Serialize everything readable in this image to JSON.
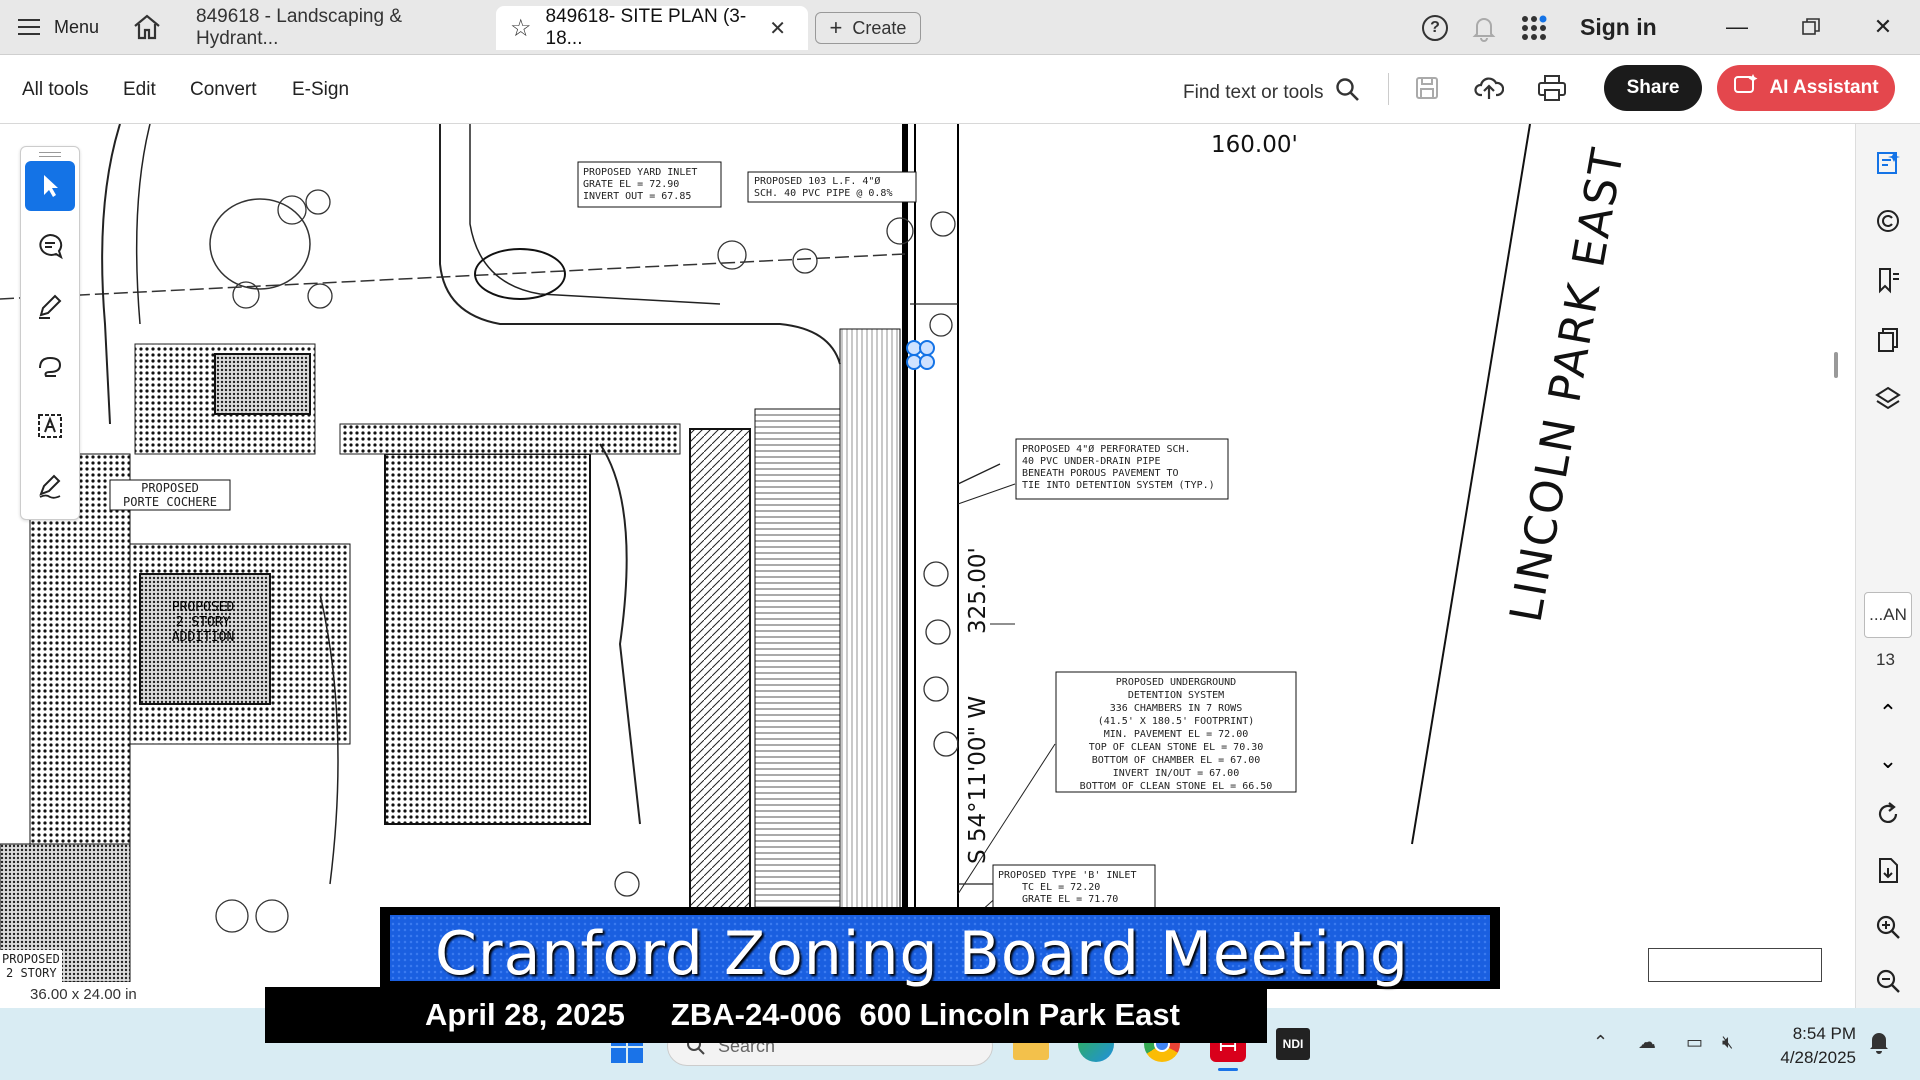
{
  "titlebar": {
    "menu_label": "Menu",
    "tabs": [
      {
        "label": "849618 - Landscaping & Hydrant..."
      },
      {
        "label": "849618- SITE PLAN (3-18..."
      }
    ],
    "create_label": "Create",
    "sign_in_label": "Sign in"
  },
  "toolbar": {
    "items": [
      "All tools",
      "Edit",
      "Convert",
      "E-Sign"
    ],
    "find_label": "Find text or tools",
    "share_label": "Share",
    "ai_label": "AI Assistant"
  },
  "drawing": {
    "dim_top": "160.00'",
    "dim_right": "325.00'",
    "bearing": "S 54°11'00\" W",
    "street": "LINCOLN PARK EAST",
    "notes": {
      "yard_inlet": [
        "PROPOSED YARD INLET",
        "GRATE EL = 72.90",
        "INVERT OUT = 67.85"
      ],
      "pvc_pipe": [
        "PROPOSED 103 L.F. 4\"Ø",
        "SCH. 40 PVC PIPE @ 0.8%"
      ],
      "underdrain": [
        "PROPOSED 4\"Ø PERFORATED SCH.",
        "40 PVC UNDER-DRAIN PIPE",
        "BENEATH POROUS PAVEMENT TO",
        "TIE INTO DETENTION SYSTEM (TYP.)"
      ],
      "detention": [
        "PROPOSED UNDERGROUND",
        "DETENTION SYSTEM",
        "336 CHAMBERS IN 7 ROWS",
        "(41.5' X 180.5' FOOTPRINT)",
        "MIN. PAVEMENT EL = 72.00",
        "TOP OF CLEAN STONE EL = 70.30",
        "BOTTOM OF CHAMBER EL = 67.00",
        "INVERT IN/OUT = 67.00",
        "BOTTOM OF CLEAN STONE EL = 66.50"
      ],
      "type_b_inlet": [
        "PROPOSED TYPE 'B' INLET",
        "TC EL = 72.20",
        "GRATE EL = 71.70"
      ],
      "porte_cochere": [
        "PROPOSED",
        "PORTE COCHERE"
      ],
      "addition": [
        "PROPOSED",
        "2 STORY",
        "ADDITION"
      ],
      "proposed_2story": [
        "PROPOSED",
        "2 STORY"
      ]
    }
  },
  "rail": {
    "page_label": "...AN",
    "page_count": "13"
  },
  "status": {
    "page_size": "36.00 x 24.00 in"
  },
  "overlay": {
    "title": "Cranford Zoning Board Meeting",
    "date": "April 28, 2025",
    "case": "ZBA-24-006",
    "address": "600 Lincoln Park East"
  },
  "taskbar": {
    "search_placeholder": "Search",
    "time": "8:54 PM",
    "date": "4/28/2025"
  },
  "colors": {
    "accent_blue": "#1473e6",
    "ai_red": "#e4474d",
    "banner_blue": "#1a5fe0"
  }
}
